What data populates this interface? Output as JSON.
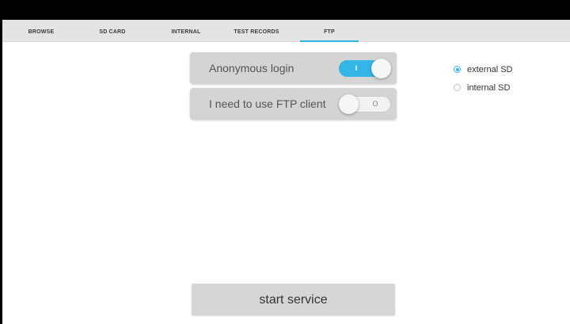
{
  "tabs": [
    {
      "label": "BROWSE",
      "selected": false
    },
    {
      "label": "SD CARD",
      "selected": false
    },
    {
      "label": "INTERNAL",
      "selected": false
    },
    {
      "label": "TEST RECORDS",
      "selected": false
    },
    {
      "label": "FTP",
      "selected": true
    }
  ],
  "settings": {
    "anonymous_login": {
      "label": "Anonymous login",
      "state": "on",
      "mark": "I"
    },
    "ftp_client": {
      "label": "I need to use FTP client",
      "state": "off",
      "mark": "O"
    }
  },
  "storage": {
    "options": [
      {
        "label": "external SD",
        "checked": true
      },
      {
        "label": "internal SD",
        "checked": false
      }
    ]
  },
  "actions": {
    "start_label": "start service"
  },
  "colors": {
    "accent": "#33b5e5",
    "panel": "#d4d4d4",
    "tabbar": "#e4e4e4",
    "status_bar": "#000000"
  }
}
